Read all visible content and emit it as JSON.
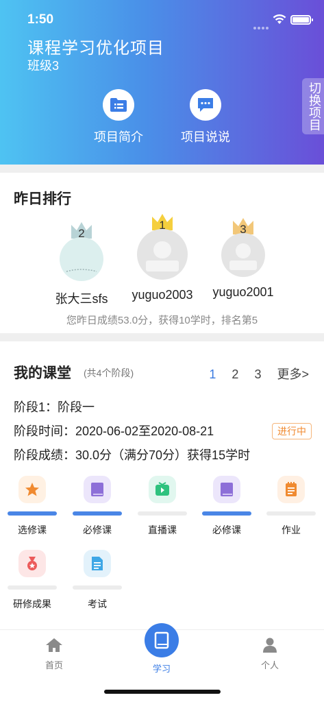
{
  "status_bar": {
    "time": "1:50"
  },
  "header": {
    "title": "课程学习优化项目",
    "class_name": "班级3",
    "switch_label": "切换项目",
    "buttons": [
      {
        "label": "项目简介",
        "icon": "folder-list-icon"
      },
      {
        "label": "项目说说",
        "icon": "chat-bubble-icon"
      }
    ]
  },
  "ranking": {
    "title": "昨日排行",
    "items": [
      {
        "rank": "2",
        "name": "张大三sfs",
        "crown_color": "#b8d3d6"
      },
      {
        "rank": "1",
        "name": "yuguo2003",
        "crown_color": "#f5cf3e"
      },
      {
        "rank": "3",
        "name": "yuguo2001",
        "crown_color": "#f2c779"
      }
    ],
    "summary": "您昨日成绩53.0分，获得10学时，排名第5"
  },
  "classroom": {
    "title": "我的课堂",
    "subtitle": "(共4个阶段)",
    "pages": [
      "1",
      "2",
      "3"
    ],
    "active_page": "1",
    "more_label": "更多>",
    "stage_name": "阶段1：阶段一",
    "stage_time": "阶段时间：2020-06-02至2020-08-21",
    "stage_score": "阶段成绩：30.0分（满分70分）获得15学时",
    "status": "进行中",
    "functions": [
      {
        "label": "选修课",
        "icon": "star-icon",
        "done": true
      },
      {
        "label": "必修课",
        "icon": "book-icon",
        "done": true
      },
      {
        "label": "直播课",
        "icon": "tv-play-icon",
        "done": false
      },
      {
        "label": "必修课",
        "icon": "book-icon",
        "done": true
      },
      {
        "label": "作业",
        "icon": "notepad-icon",
        "done": false
      },
      {
        "label": "研修成果",
        "icon": "medal-icon",
        "done": false
      },
      {
        "label": "考试",
        "icon": "document-icon",
        "done": false
      }
    ]
  },
  "tabbar": {
    "tabs": [
      {
        "label": "首页",
        "icon": "home-icon"
      },
      {
        "label": "学习",
        "icon": "book-icon"
      },
      {
        "label": "个人",
        "icon": "user-icon"
      }
    ],
    "active": "学习",
    "active_color": "#3b7de6"
  }
}
